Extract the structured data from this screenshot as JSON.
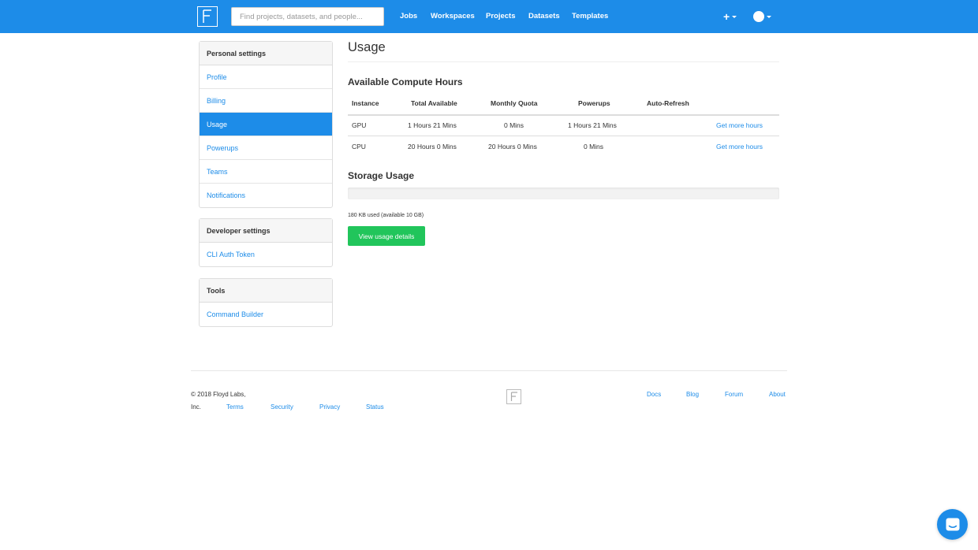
{
  "nav": {
    "search_placeholder": "Find projects, datasets, and people...",
    "links": [
      "Jobs",
      "Workspaces",
      "Projects",
      "Datasets",
      "Templates"
    ],
    "plus_icon": "+",
    "brand_color": "#1d8ce8"
  },
  "sidebar": {
    "personal": {
      "heading": "Personal settings",
      "items": [
        "Profile",
        "Billing",
        "Usage",
        "Powerups",
        "Teams",
        "Notifications"
      ],
      "active_item": "Usage"
    },
    "developer": {
      "heading": "Developer settings",
      "items": [
        "CLI Auth Token"
      ]
    },
    "tools": {
      "heading": "Tools",
      "items": [
        "Command Builder"
      ]
    }
  },
  "main": {
    "title": "Usage",
    "compute": {
      "title": "Available Compute Hours",
      "headers": [
        "Instance",
        "Total Available",
        "Monthly Quota",
        "Powerups",
        "Auto-Refresh"
      ],
      "rows": [
        {
          "instance": "GPU",
          "total": "1 Hours 21 Mins",
          "quota": "0 Mins",
          "powerups": "1 Hours 21 Mins",
          "action": "Get more hours"
        },
        {
          "instance": "CPU",
          "total": "20 Hours 0 Mins",
          "quota": "20 Hours 0 Mins",
          "powerups": "0 Mins",
          "action": "Get more hours"
        }
      ]
    },
    "storage": {
      "title": "Storage Usage",
      "used_fraction": 0.0,
      "text": "180 KB used (available 10 GB)",
      "button": "View usage details",
      "button_color": "#21c55b"
    }
  },
  "footer": {
    "copyright_line1": "© 2018 Floyd Labs,",
    "copyright_line2": "Inc.",
    "left_links": [
      "Terms",
      "Security",
      "Privacy",
      "Status"
    ],
    "right_links": [
      "Docs",
      "Blog",
      "Forum",
      "About"
    ]
  },
  "chat": {
    "icon": "chat-icon"
  }
}
